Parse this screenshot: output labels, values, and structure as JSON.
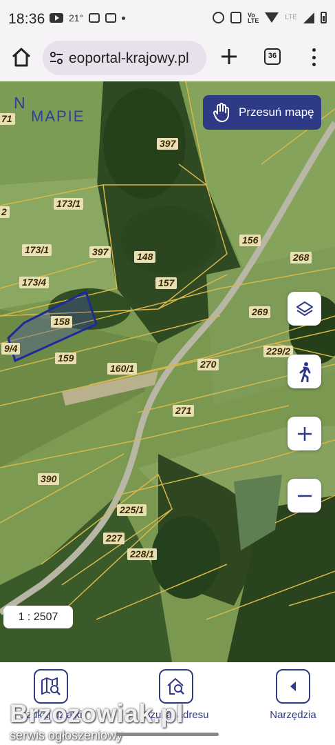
{
  "status_bar": {
    "time": "18:36",
    "temperature": "21°",
    "network_label": "LTE",
    "icons": [
      "youtube-icon",
      "message-icon",
      "message-icon",
      "dot-icon",
      "alarm-icon",
      "nfc-icon",
      "volte-icon",
      "wifi-icon",
      "signal-icon",
      "battery-icon"
    ]
  },
  "browser": {
    "url": "eoportal-krajowy.pl",
    "tab_count": "36",
    "icons": [
      "home-icon",
      "site-info-icon",
      "plus-icon",
      "tabs-icon",
      "more-vert-icon"
    ]
  },
  "map": {
    "logo_na": "N",
    "logo_mapie": "MAPIE",
    "move_map_button": "Przesuń mapę",
    "scale": "1 : 2507",
    "selected_parcel": "158",
    "parcels": [
      {
        "label": "71"
      },
      {
        "label": "397"
      },
      {
        "label": "173/1"
      },
      {
        "label": "2"
      },
      {
        "label": "173/1"
      },
      {
        "label": "397"
      },
      {
        "label": "148"
      },
      {
        "label": "156"
      },
      {
        "label": "268"
      },
      {
        "label": "173/4"
      },
      {
        "label": "157"
      },
      {
        "label": "158"
      },
      {
        "label": "269"
      },
      {
        "label": "9/4"
      },
      {
        "label": "159"
      },
      {
        "label": "229/2"
      },
      {
        "label": "160/1"
      },
      {
        "label": "270"
      },
      {
        "label": "271"
      },
      {
        "label": "390"
      },
      {
        "label": "225/1"
      },
      {
        "label": "227"
      },
      {
        "label": "228/1"
      }
    ],
    "controls": [
      "layers-icon",
      "street-view-icon",
      "zoom-in-icon",
      "zoom-out-icon"
    ]
  },
  "bottom_nav": {
    "items": [
      {
        "label": "Szukaj działki",
        "icon": "map-search-icon"
      },
      {
        "label": "Szukaj adresu",
        "icon": "home-search-icon"
      },
      {
        "label": "Narzędzia",
        "icon": "chevron-left-icon"
      }
    ]
  },
  "watermark": {
    "brand": "Brzozowiak.pl",
    "tagline": "serwis ogłoszeniowy"
  },
  "colors": {
    "accent": "#2f3a86",
    "parcel_border": "#d7b84a",
    "selected_parcel_border": "#1f2a9a",
    "map_green": "#6f8f4c"
  }
}
